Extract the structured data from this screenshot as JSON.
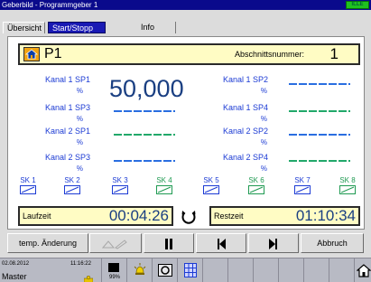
{
  "window": {
    "title": "Geberbild - Programmgeber 1",
    "status_label": "ILLE"
  },
  "tabs": [
    {
      "label": "Übersicht"
    },
    {
      "label": "Start/Stopp"
    },
    {
      "label": "Info"
    }
  ],
  "header": {
    "program": "P1",
    "section_label": "Abschnittsnummer:",
    "section_value": "1"
  },
  "channels": [
    {
      "name": "Kanal 1 SP1",
      "unit": "%",
      "value": "50,000"
    },
    {
      "name": "Kanal 1 SP2",
      "unit": "%"
    },
    {
      "name": "Kanal 1 SP3",
      "unit": "%"
    },
    {
      "name": "Kanal 1 SP4",
      "unit": "%"
    },
    {
      "name": "Kanal 2 SP1",
      "unit": "%"
    },
    {
      "name": "Kanal 2 SP2",
      "unit": "%"
    },
    {
      "name": "Kanal 2 SP3",
      "unit": "%"
    },
    {
      "name": "Kanal 2 SP4",
      "unit": "%"
    }
  ],
  "switch_contacts": [
    {
      "label": "SK 1"
    },
    {
      "label": "SK 2"
    },
    {
      "label": "SK 3"
    },
    {
      "label": "SK 4"
    },
    {
      "label": "SK 5"
    },
    {
      "label": "SK 6"
    },
    {
      "label": "SK 7"
    },
    {
      "label": "SK 8"
    }
  ],
  "runtime": {
    "label": "Laufzeit",
    "value": "00:04:26"
  },
  "remaining": {
    "label": "Restzeit",
    "value": "01:10:34"
  },
  "buttons": {
    "temp_change": "temp. Änderung",
    "abort": "Abbruch"
  },
  "statusbar": {
    "date": "02.08.2012",
    "time": "11:16:22",
    "user": "Master",
    "memory": "99%"
  },
  "colors": {
    "accent_blue": "#1c3bd4",
    "accent_green": "#1f9a52",
    "highlight": "#fffcc4",
    "home_orange": "#f2a410"
  }
}
